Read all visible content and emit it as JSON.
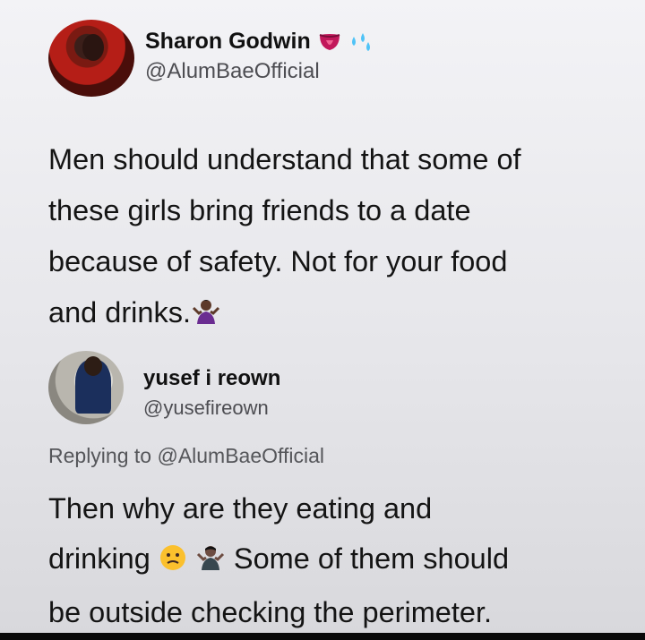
{
  "tweet": {
    "author": {
      "name": "Sharon Godwin",
      "handle": "@AlumBaeOfficial",
      "name_emojis": [
        "tongue-face-emoji",
        "sweat-droplets-emoji"
      ]
    },
    "text_lines": [
      "Men should understand that some of",
      "these girls bring friends to a date",
      "because of safety. Not for your food",
      "and drinks."
    ],
    "trailing_emoji": "woman-shrugging-emoji"
  },
  "reply": {
    "author": {
      "name": "yusef i reown",
      "handle": "@yusefireown"
    },
    "replying_prefix": "Replying to",
    "replying_to": "@AlumBaeOfficial",
    "text_lines": [
      "Then why are they eating and",
      "drinking",
      "Some of them should",
      "be outside checking the perimeter."
    ],
    "inline_emojis": [
      "confused-face-emoji",
      "man-shrugging-emoji"
    ]
  },
  "colors": {
    "text": "#141414",
    "secondary_text": "#4d4d52",
    "emoji_pink": "#d4145a",
    "emoji_purple": "#6a2c91"
  }
}
